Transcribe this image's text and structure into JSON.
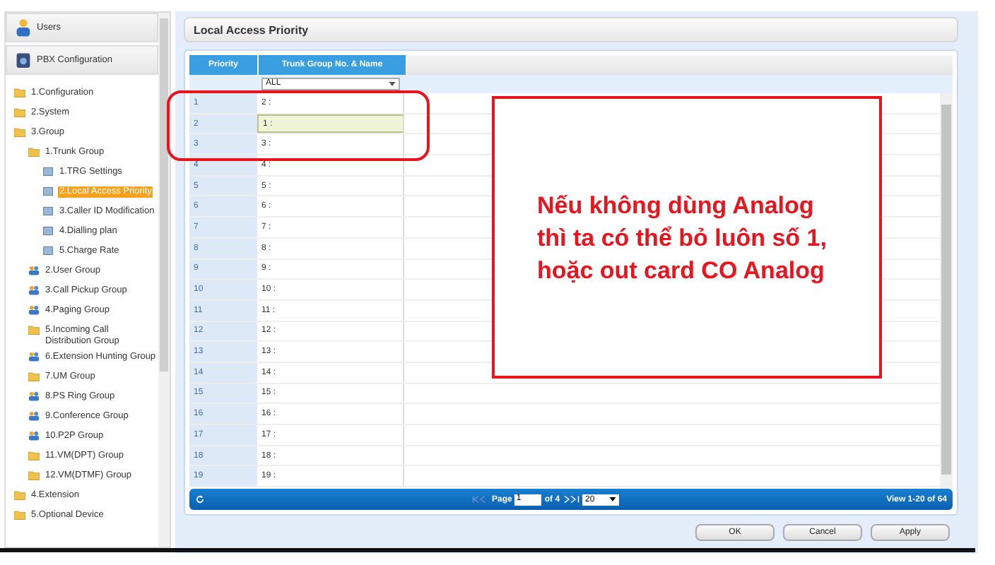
{
  "sidebar": {
    "sections": [
      {
        "label": "Users",
        "kind": "users"
      },
      {
        "label": "PBX Configuration",
        "kind": "pbx"
      }
    ],
    "tree": [
      {
        "label": "1.Configuration",
        "kind": "folder",
        "selected": false
      },
      {
        "label": "2.System",
        "kind": "folder",
        "selected": false
      },
      {
        "label": "3.Group",
        "kind": "folder",
        "selected": false,
        "children": [
          {
            "label": "1.Trunk Group",
            "kind": "folder",
            "selected": false,
            "children": [
              {
                "label": "1.TRG Settings",
                "kind": "page",
                "selected": false
              },
              {
                "label": "2.Local Access Priority",
                "kind": "page",
                "selected": true
              },
              {
                "label": "3.Caller ID Modification",
                "kind": "page",
                "selected": false
              },
              {
                "label": "4.Dialling plan",
                "kind": "page",
                "selected": false
              },
              {
                "label": "5.Charge Rate",
                "kind": "page",
                "selected": false
              }
            ]
          },
          {
            "label": "2.User Group",
            "kind": "people",
            "selected": false
          },
          {
            "label": "3.Call Pickup Group",
            "kind": "people",
            "selected": false
          },
          {
            "label": "4.Paging Group",
            "kind": "people",
            "selected": false
          },
          {
            "label": "5.Incoming Call Distribution Group",
            "kind": "folder",
            "selected": false
          },
          {
            "label": "6.Extension Hunting Group",
            "kind": "people",
            "selected": false
          },
          {
            "label": "7.UM Group",
            "kind": "folder",
            "selected": false
          },
          {
            "label": "8.PS Ring Group",
            "kind": "people",
            "selected": false
          },
          {
            "label": "9.Conference Group",
            "kind": "people",
            "selected": false
          },
          {
            "label": "10.P2P Group",
            "kind": "people",
            "selected": false
          },
          {
            "label": "11.VM(DPT) Group",
            "kind": "folder",
            "selected": false
          },
          {
            "label": "12.VM(DTMF) Group",
            "kind": "folder",
            "selected": false
          }
        ]
      },
      {
        "label": "4.Extension",
        "kind": "folder",
        "selected": false
      },
      {
        "label": "5.Optional Device",
        "kind": "folder",
        "selected": false
      }
    ]
  },
  "panel": {
    "title": "Local Access Priority"
  },
  "table": {
    "columns": [
      "Priority",
      "Trunk Group No. & Name"
    ],
    "filter": "ALL",
    "rows": [
      {
        "priority": "1",
        "trunk": "2 :",
        "selected": false
      },
      {
        "priority": "2",
        "trunk": "1 :",
        "selected": true
      },
      {
        "priority": "3",
        "trunk": "3 :",
        "selected": false
      },
      {
        "priority": "4",
        "trunk": "4 :",
        "selected": false
      },
      {
        "priority": "5",
        "trunk": "5 :",
        "selected": false
      },
      {
        "priority": "6",
        "trunk": "6 :",
        "selected": false
      },
      {
        "priority": "7",
        "trunk": "7 :",
        "selected": false
      },
      {
        "priority": "8",
        "trunk": "8 :",
        "selected": false
      },
      {
        "priority": "9",
        "trunk": "9 :",
        "selected": false
      },
      {
        "priority": "10",
        "trunk": "10 :",
        "selected": false
      },
      {
        "priority": "11",
        "trunk": "11 :",
        "selected": false
      },
      {
        "priority": "12",
        "trunk": "12 :",
        "selected": false
      },
      {
        "priority": "13",
        "trunk": "13 :",
        "selected": false
      },
      {
        "priority": "14",
        "trunk": "14 :",
        "selected": false
      },
      {
        "priority": "15",
        "trunk": "15 :",
        "selected": false
      },
      {
        "priority": "16",
        "trunk": "16 :",
        "selected": false
      },
      {
        "priority": "17",
        "trunk": "17 :",
        "selected": false
      },
      {
        "priority": "18",
        "trunk": "18 :",
        "selected": false
      },
      {
        "priority": "19",
        "trunk": "19 :",
        "selected": false
      }
    ]
  },
  "pager": {
    "page_label": "Page",
    "page": "1",
    "of": "of 4",
    "page_size": "20",
    "view": "View 1-20 of 64"
  },
  "buttons": [
    "OK",
    "Cancel",
    "Apply"
  ],
  "annotation": {
    "text": "Nếu không dùng Analog thì ta có thể bỏ luôn số 1, hoặc out card CO Analog"
  }
}
